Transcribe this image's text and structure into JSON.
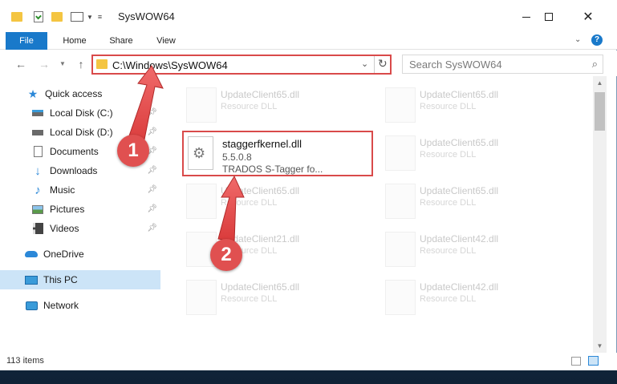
{
  "window": {
    "title": "SysWOW64"
  },
  "ribbon": {
    "tabs": [
      "File",
      "Home",
      "Share",
      "View"
    ]
  },
  "address": {
    "path": "C:\\Windows\\SysWOW64",
    "search_placeholder": "Search SysWOW64"
  },
  "sidebar": {
    "items": [
      {
        "label": "Quick access",
        "icon": "star-icon",
        "pinned": false
      },
      {
        "label": "Local Disk (C:)",
        "icon": "drive-icon",
        "pinned": true
      },
      {
        "label": "Local Disk (D:)",
        "icon": "drive-icon",
        "pinned": true
      },
      {
        "label": "Documents",
        "icon": "documents-icon",
        "pinned": true
      },
      {
        "label": "Downloads",
        "icon": "download-icon",
        "pinned": true
      },
      {
        "label": "Music",
        "icon": "music-icon",
        "pinned": true
      },
      {
        "label": "Pictures",
        "icon": "pictures-icon",
        "pinned": true
      },
      {
        "label": "Videos",
        "icon": "videos-icon",
        "pinned": true
      },
      {
        "label": "OneDrive",
        "icon": "cloud-icon",
        "pinned": false
      },
      {
        "label": "This PC",
        "icon": "computer-icon",
        "pinned": false,
        "selected": true
      },
      {
        "label": "Network",
        "icon": "network-icon",
        "pinned": false
      }
    ]
  },
  "files": {
    "left": [
      {
        "name": "UpdateClient65.dll",
        "desc": "Resource DLL"
      },
      {
        "name": "UpdateClient65.dll",
        "desc": "Resource DLL"
      },
      {
        "name": "UpdateClient21.dll",
        "desc": "Resource DLL"
      },
      {
        "name": "UpdateClient65.dll",
        "desc": "Resource DLL"
      }
    ],
    "right": [
      {
        "name": "UpdateClient65.dll",
        "desc": "Resource DLL"
      },
      {
        "name": "UpdateClient65.dll",
        "desc": "Resource DLL"
      },
      {
        "name": "UpdateClient65.dll",
        "desc": "Resource DLL"
      },
      {
        "name": "UpdateClient42.dll",
        "desc": "Resource DLL"
      },
      {
        "name": "UpdateClient42.dll",
        "desc": "Resource DLL"
      }
    ],
    "highlighted": {
      "name": "staggerfkernel.dll",
      "version": "5.5.0.8",
      "desc": "TRADOS S-Tagger  fo..."
    }
  },
  "status": {
    "items_count": "113 items"
  },
  "callouts": [
    "1",
    "2"
  ],
  "colors": {
    "accent": "#1979ca",
    "highlight": "#d94a4a",
    "selected": "#cce4f7"
  }
}
